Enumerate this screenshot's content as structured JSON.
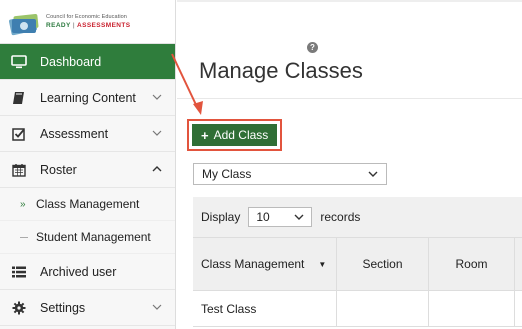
{
  "logo": {
    "line1": "Council for Economic Education",
    "brand_left": "READY",
    "brand_right": "ASSESSMENTS"
  },
  "sidebar": {
    "items": [
      {
        "label": "Dashboard",
        "icon": "monitor-icon",
        "active": true
      },
      {
        "label": "Learning Content",
        "icon": "book-icon",
        "chevron": "down"
      },
      {
        "label": "Assessment",
        "icon": "checkbox-icon",
        "chevron": "down"
      },
      {
        "label": "Roster",
        "icon": "calendar-icon",
        "chevron": "up"
      },
      {
        "label": "Archived user",
        "icon": "list-icon"
      },
      {
        "label": "Settings",
        "icon": "gear-icon",
        "chevron": "down"
      }
    ],
    "sub_items": [
      {
        "label": "Class Management",
        "current": true
      },
      {
        "label": "Student Management",
        "current": false
      }
    ]
  },
  "main": {
    "help_glyph": "?",
    "title": "Manage Classes",
    "add_button": {
      "plus": "+",
      "label": "Add Class"
    },
    "class_select": {
      "value": "My Class"
    },
    "table": {
      "display_label": "Display",
      "page_length": "10",
      "records_label": "records",
      "columns": [
        "Class Management",
        "Section",
        "Room",
        ""
      ],
      "rows": [
        [
          "Test Class",
          "",
          "",
          ""
        ]
      ]
    }
  },
  "colors": {
    "accent_green": "#2f7d3c",
    "button_green": "#2f6e35",
    "annotation_red": "#e2543d"
  }
}
